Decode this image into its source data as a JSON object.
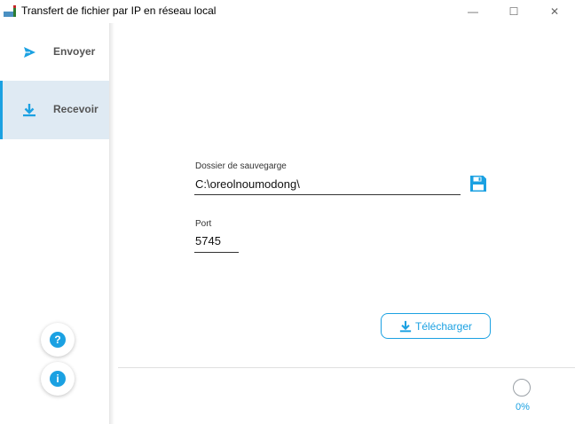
{
  "window": {
    "title": "Transfert de fichier par IP en réseau local",
    "minimize": "—",
    "maximize": "☐",
    "close": "✕"
  },
  "sidebar": {
    "items": [
      {
        "label": "Envoyer",
        "icon": "send-icon",
        "active": false
      },
      {
        "label": "Recevoir",
        "icon": "download-icon",
        "active": true
      }
    ],
    "help": "?",
    "info": "i"
  },
  "receive": {
    "folder_label": "Dossier de sauvegarge",
    "folder_value": "C:\\oreolnoumodong\\",
    "port_label": "Port",
    "port_value": "5745",
    "download_label": "Télécharger",
    "progress": "0%"
  },
  "colors": {
    "accent": "#1ba1e2",
    "sidebar_active_bg": "#dfeaf3"
  }
}
